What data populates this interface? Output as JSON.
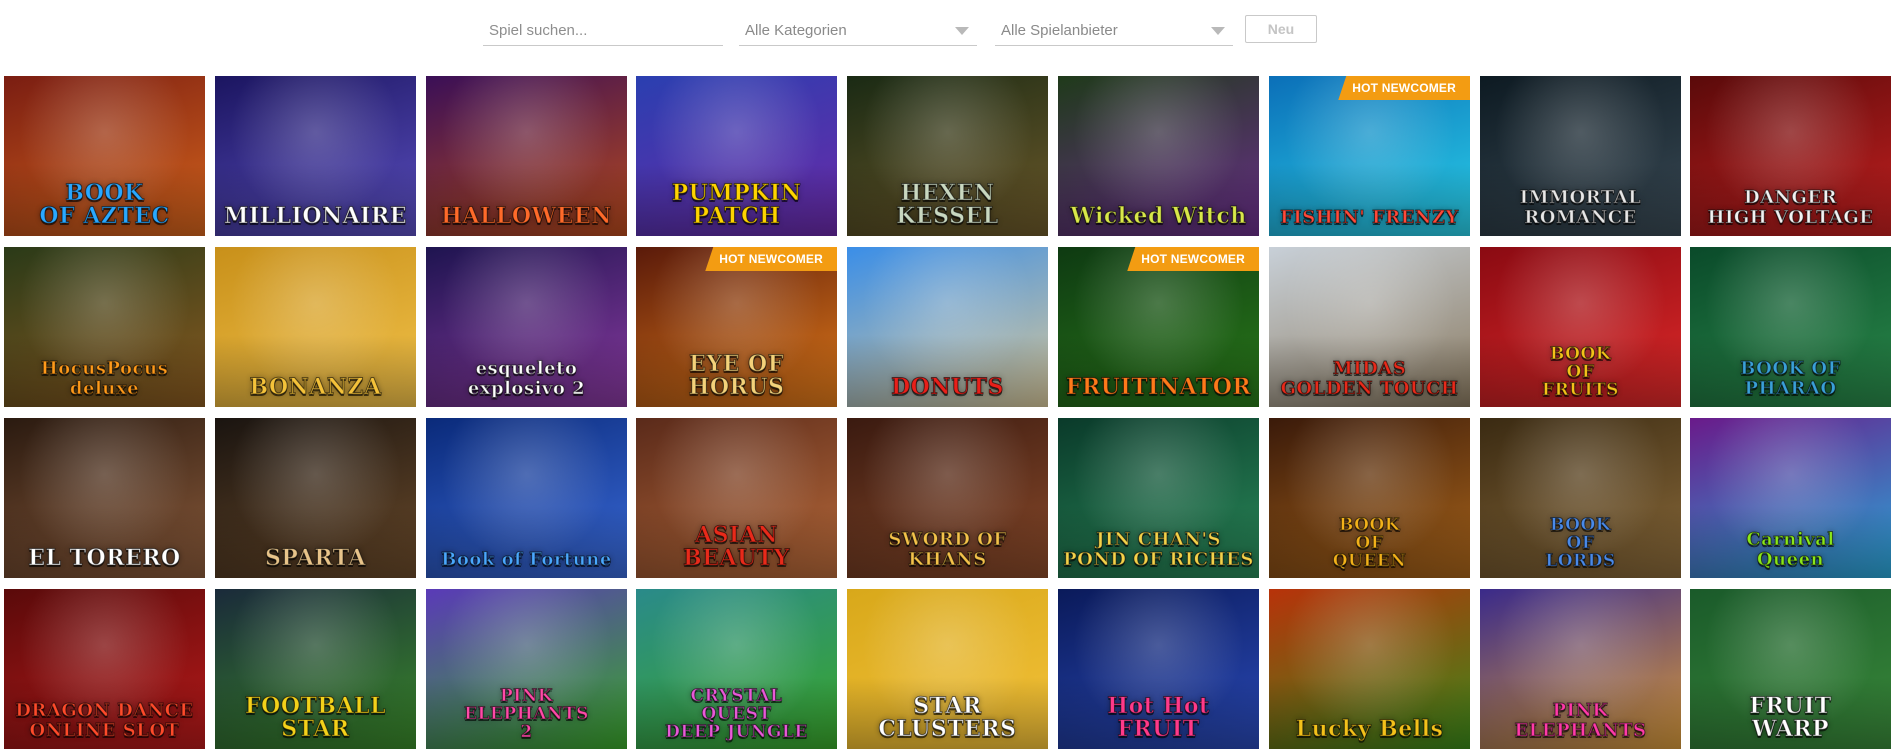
{
  "filters": {
    "search_placeholder": "Spiel suchen...",
    "category_value": "Alle Kategorien",
    "provider_value": "Alle Spielanbieter",
    "new_button": "Neu"
  },
  "badge_text": "HOT NEWCOMER",
  "games": [
    {
      "title": "BOOK\nOF AZTEC",
      "bg": [
        "#7a1d12",
        "#d4641c"
      ],
      "text": "#2aa8ff",
      "hot": false,
      "icon": "book-icon"
    },
    {
      "title": "MILLIONAIRE",
      "bg": [
        "#1b1560",
        "#5b4fc0"
      ],
      "text": "#ffffff",
      "hot": false,
      "icon": "wheel-icon"
    },
    {
      "title": "HALLOWEEN",
      "bg": [
        "#3a0f57",
        "#b84a1c"
      ],
      "text": "#ff6a2a",
      "hot": false,
      "icon": "pumpkin-icon"
    },
    {
      "title": "PUMPKIN\nPATCH",
      "bg": [
        "#2a3fb0",
        "#6b2aa8"
      ],
      "text": "#ffd400",
      "hot": false,
      "icon": "scarecrow-icon"
    },
    {
      "title": "HEXEN KESSEL",
      "bg": [
        "#1a2a14",
        "#6e5a2a"
      ],
      "text": "#c9d8c0",
      "hot": false,
      "icon": "cauldron-icon"
    },
    {
      "title": "Wicked Witch",
      "bg": [
        "#1f3a1a",
        "#6a2f8a"
      ],
      "text": "#d9e84a",
      "hot": false,
      "icon": "witch-icon"
    },
    {
      "title": "FISHIN' FRENZY",
      "bg": [
        "#0b6fb8",
        "#2ad0e8"
      ],
      "text": "#ff4a3a",
      "hot": true,
      "icon": "fish-icon"
    },
    {
      "title": "IMMORTAL ROMANCE",
      "bg": [
        "#0d1a22",
        "#3a4a55"
      ],
      "text": "#e8e8e8",
      "hot": false,
      "icon": "vampire-icon"
    },
    {
      "title": "DANGER\nHIGH VOLTAGE",
      "bg": [
        "#5a0a0a",
        "#c42020"
      ],
      "text": "#f2f2f2",
      "hot": false,
      "icon": "lightning-icon"
    },
    {
      "title": "HocusPocus\ndeluxe",
      "bg": [
        "#2a3a18",
        "#8a5a20"
      ],
      "text": "#ff9a1a",
      "hot": false,
      "icon": "wizard-icon"
    },
    {
      "title": "BONANZA",
      "bg": [
        "#c8901a",
        "#f2c24a"
      ],
      "text": "#f4c23a",
      "hot": false,
      "icon": "gem-icon"
    },
    {
      "title": "esqueleto\nexplosivo 2",
      "bg": [
        "#1e1450",
        "#8a3aa0"
      ],
      "text": "#ffffff",
      "hot": false,
      "icon": "skull-icon"
    },
    {
      "title": "EYE OF\nHORUS",
      "bg": [
        "#5a1a0a",
        "#e07a1a"
      ],
      "text": "#f4d27a",
      "hot": true,
      "icon": "falcon-icon"
    },
    {
      "title": "DONUTS",
      "bg": [
        "#3a8ee8",
        "#d8c89a"
      ],
      "text": "#e8201a",
      "hot": false,
      "icon": "donut-icon"
    },
    {
      "title": "FRUITINATOR",
      "bg": [
        "#0e3a12",
        "#2a7a1a"
      ],
      "text": "#ff7a1a",
      "hot": true,
      "icon": "seven-icon"
    },
    {
      "title": "MIDAS\nGOLDEN TOUCH",
      "bg": [
        "#c8d0d8",
        "#8a7a60"
      ],
      "text": "#e82a1a",
      "hot": false,
      "icon": "king-icon"
    },
    {
      "title": "BOOK\nOF\nFRUITS",
      "bg": [
        "#8a0a12",
        "#e02a2a"
      ],
      "text": "#f4c21a",
      "hot": false,
      "icon": "book-icon"
    },
    {
      "title": "BOOK OF\nPHARAO",
      "bg": [
        "#0a4a2a",
        "#2a8a4a"
      ],
      "text": "#3aa0d8",
      "hot": false,
      "icon": "pharao-icon"
    },
    {
      "title": "EL TORERO",
      "bg": [
        "#2a1a10",
        "#8a5a3a"
      ],
      "text": "#ffffff",
      "hot": false,
      "icon": "torero-icon"
    },
    {
      "title": "SPARTA",
      "bg": [
        "#1a1410",
        "#6a4a2a"
      ],
      "text": "#e8c48a",
      "hot": false,
      "icon": "helmet-icon"
    },
    {
      "title": "Book of Fortune",
      "bg": [
        "#0a2a7a",
        "#3a6ad8"
      ],
      "text": "#4aa8ff",
      "hot": false,
      "icon": "book-icon"
    },
    {
      "title": "ASIAN\nBEAUTY",
      "bg": [
        "#5a2a1a",
        "#b86a3a"
      ],
      "text": "#e82a1a",
      "hot": false,
      "icon": "geisha-icon"
    },
    {
      "title": "SWORD OF KHANS",
      "bg": [
        "#3a1a10",
        "#8a4a2a"
      ],
      "text": "#f4c24a",
      "hot": false,
      "icon": "sword-icon"
    },
    {
      "title": "JIN CHAN'S\nPOND OF RICHES",
      "bg": [
        "#0a3a2a",
        "#2a8a5a"
      ],
      "text": "#f4d24a",
      "hot": false,
      "icon": "crane-icon"
    },
    {
      "title": "BOOK\nOF\nQUEEN",
      "bg": [
        "#3a1a0a",
        "#a8641a"
      ],
      "text": "#f4b21a",
      "hot": false,
      "icon": "queen-icon"
    },
    {
      "title": "BOOK\nOF\nLORDS",
      "bg": [
        "#3a2a12",
        "#8a6a3a"
      ],
      "text": "#4a8ae8",
      "hot": false,
      "icon": "explorer-icon"
    },
    {
      "title": "Carnival\nQueen",
      "bg": [
        "#6a1a8a",
        "#2aa8d8"
      ],
      "text": "#8ae81a",
      "hot": false,
      "icon": "mask-icon"
    },
    {
      "title": "DRAGON DANCE\nONLINE SLOT",
      "bg": [
        "#5a0a0a",
        "#b81a1a"
      ],
      "text": "#ff4a2a",
      "hot": false,
      "icon": "drum-icon"
    },
    {
      "title": "FOOTBALL STAR",
      "bg": [
        "#1a2a3a",
        "#3a8a2a"
      ],
      "text": "#f4d21a",
      "hot": false,
      "icon": "football-icon"
    },
    {
      "title": "PINK\nELEPHANTS\n2",
      "bg": [
        "#5a3ab8",
        "#3aa82a"
      ],
      "text": "#ff4aa8",
      "hot": false,
      "icon": "elephant-icon"
    },
    {
      "title": "CRYSTAL\nQUEST\nDEEP JUNGLE",
      "bg": [
        "#2a8a8a",
        "#3aa82a"
      ],
      "text": "#e85ad8",
      "hot": false,
      "icon": "gem-icon"
    },
    {
      "title": "STAR\nCLUSTERS",
      "bg": [
        "#d8a81a",
        "#f4c23a"
      ],
      "text": "#ffffff",
      "hot": false,
      "icon": "star-icon"
    },
    {
      "title": "Hot Hot\nFRUIT",
      "bg": [
        "#0a1a5a",
        "#2a4ab8"
      ],
      "text": "#ff3a8a",
      "hot": false,
      "icon": "fruit-icon"
    },
    {
      "title": "Lucky Bells",
      "bg": [
        "#b8320a",
        "#3a8a1a"
      ],
      "text": "#f4c21a",
      "hot": false,
      "icon": "grapes-icon"
    },
    {
      "title": "PINK\nELEPHANTS",
      "bg": [
        "#3a2a8a",
        "#d89a3a"
      ],
      "text": "#ff3aa8",
      "hot": false,
      "icon": "elephant-icon"
    },
    {
      "title": "FRUIT\nWARP",
      "bg": [
        "#1a5a2a",
        "#3a8a3a"
      ],
      "text": "#ffffff",
      "hot": false,
      "icon": "dragonfruit-icon"
    }
  ]
}
